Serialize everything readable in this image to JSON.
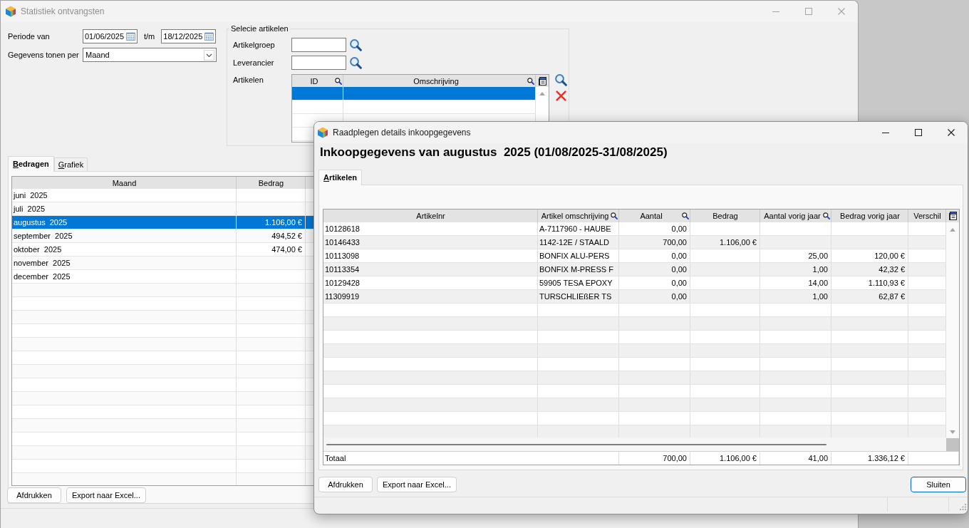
{
  "main_window": {
    "title": "Statistiek ontvangsten",
    "active": false
  },
  "filters": {
    "period_label": "Periode van",
    "date_from": "01/06/2025",
    "to_label": "t/m",
    "date_to": "18/12/2025",
    "group_by_label": "Gegevens tonen per",
    "group_by": "Maand"
  },
  "article_selection": {
    "title": "Selecie artikelen",
    "fields": [
      {
        "label": "Artikelgroep"
      },
      {
        "label": "Leverancier"
      }
    ],
    "articles_label": "Artikelen",
    "grid": {
      "columns": [
        {
          "label": "ID",
          "filterable": true
        },
        {
          "label": "Omschrijving",
          "filterable": true
        }
      ],
      "rows": [
        {
          "selected": true
        },
        {
          "selected": false
        },
        {
          "selected": false
        }
      ]
    }
  },
  "result_tabs": [
    {
      "label": "Bedragen",
      "selected": true
    },
    {
      "label": "Grafiek",
      "selected": false
    }
  ],
  "months_table": {
    "columns": [
      {
        "label": "Maand",
        "kind": "text"
      },
      {
        "label": "Bedrag",
        "kind": "number"
      }
    ],
    "rows": [
      {
        "month": "juni  2025",
        "selected": false
      },
      {
        "month": "juli  2025",
        "selected": false
      },
      {
        "month": "augustus  2025",
        "amount": "1.106,00 €",
        "selected": true
      },
      {
        "month": "september  2025",
        "amount": "494,52 €",
        "selected": false
      },
      {
        "month": "oktober  2025",
        "amount": "474,00 €",
        "selected": false
      },
      {
        "month": "november  2025",
        "selected": false
      },
      {
        "month": "december  2025",
        "selected": false
      }
    ]
  },
  "main_buttons": [
    "Afdrukken",
    "Export naar Excel..."
  ],
  "dialog": {
    "title": "Raadplegen details inkoopgegevens",
    "active": true,
    "heading": "Inkoopgegevens van augustus  2025 (01/08/2025-31/08/2025)",
    "tabs": [
      {
        "label": "Artikelen",
        "selected": true
      }
    ],
    "table": {
      "columns": [
        {
          "label": "Artikelnr",
          "kind": "text",
          "filterable": false
        },
        {
          "label": "Artikel omschrijving",
          "kind": "text",
          "filterable": true
        },
        {
          "label": "Aantal",
          "kind": "number",
          "filterable": true
        },
        {
          "label": "Bedrag",
          "kind": "number",
          "filterable": false
        },
        {
          "label": "Aantal vorig jaar",
          "kind": "number",
          "filterable": true
        },
        {
          "label": "Bedrag vorig jaar",
          "kind": "number",
          "filterable": false
        },
        {
          "label": "Verschil",
          "kind": "number",
          "filterable": false
        }
      ],
      "rows": [
        {
          "article_no": "10128618",
          "description": "A-7117960 - HAUBE",
          "quantity": "0,00"
        },
        {
          "article_no": "10146433",
          "description": "1142-12E / STAALD",
          "quantity": "700,00",
          "amount": "1.106,00 €"
        },
        {
          "article_no": "10113098",
          "description": "BONFIX ALU-PERS",
          "quantity": "0,00",
          "quantity_prev_year": "25,00",
          "amount_prev_year": "120,00 €"
        },
        {
          "article_no": "10113354",
          "description": "BONFIX M-PRESS F",
          "quantity": "0,00",
          "quantity_prev_year": "1,00",
          "amount_prev_year": "42,32 €"
        },
        {
          "article_no": "10129428",
          "description": "59905 TESA EPOXY",
          "quantity": "0,00",
          "quantity_prev_year": "14,00",
          "amount_prev_year": "1.110,93 €"
        },
        {
          "article_no": "11309919",
          "description": "TURSCHLIEßER TS",
          "quantity": "0,00",
          "quantity_prev_year": "1,00",
          "amount_prev_year": "62,87 €"
        }
      ],
      "total": {
        "label": "Totaal",
        "quantity": "700,00",
        "amount": "1.106,00 €",
        "quantity_prev_year": "41,00",
        "amount_prev_year": "1.336,12 €"
      }
    },
    "buttons": [
      "Afdrukken",
      "Export naar Excel..."
    ],
    "close_button": {
      "label": "Sluiten",
      "default": true
    }
  }
}
